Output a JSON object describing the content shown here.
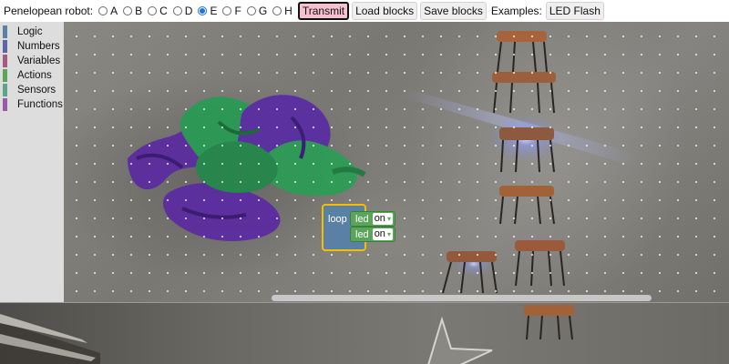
{
  "header": {
    "title": "Penelopean robot:",
    "robots": [
      {
        "label": "A",
        "checked": false
      },
      {
        "label": "B",
        "checked": false
      },
      {
        "label": "C",
        "checked": false
      },
      {
        "label": "D",
        "checked": false
      },
      {
        "label": "E",
        "checked": true
      },
      {
        "label": "F",
        "checked": false
      },
      {
        "label": "G",
        "checked": false
      },
      {
        "label": "H",
        "checked": false
      }
    ],
    "transmit_label": "Transmit",
    "load_label": "Load blocks",
    "save_label": "Save blocks",
    "examples_label": "Examples:",
    "led_flash_label": "LED Flash"
  },
  "toolbox": {
    "items": [
      {
        "label": "Logic",
        "color": "#5b80a5"
      },
      {
        "label": "Numbers",
        "color": "#5b67a5"
      },
      {
        "label": "Variables",
        "color": "#a55b80"
      },
      {
        "label": "Actions",
        "color": "#5ba55b"
      },
      {
        "label": "Sensors",
        "color": "#5ba58c"
      },
      {
        "label": "Functions",
        "color": "#995ba5"
      }
    ]
  },
  "blocks": {
    "loop_label": "loop",
    "led_rows": [
      {
        "label": "led",
        "value": "on"
      },
      {
        "label": "led",
        "value": "on"
      }
    ]
  },
  "icons": {
    "dropdown": "▾"
  }
}
